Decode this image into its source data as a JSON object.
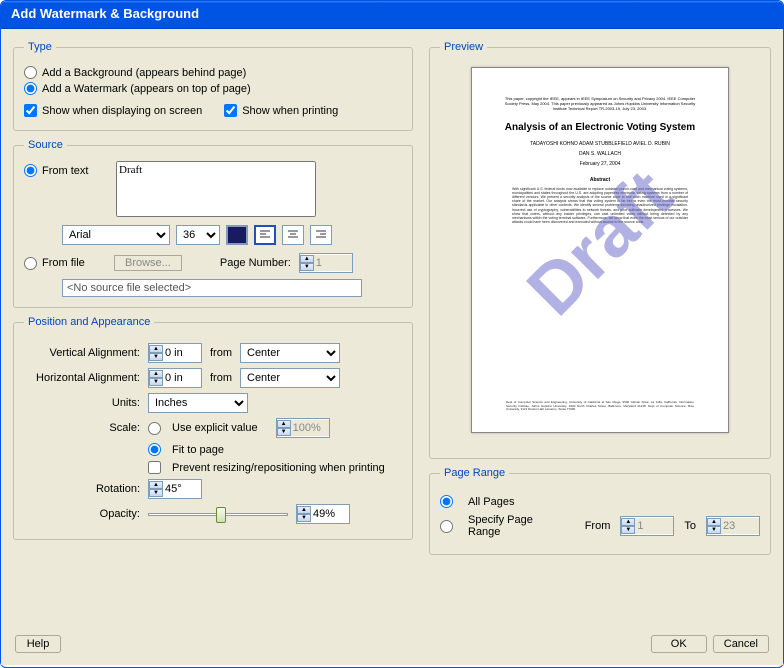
{
  "title": "Add Watermark & Background",
  "type": {
    "legend": "Type",
    "bg_label": "Add a Background (appears behind page)",
    "wm_label": "Add a Watermark (appears on top of page)",
    "show_screen": "Show when displaying on screen",
    "show_print": "Show when printing"
  },
  "source": {
    "legend": "Source",
    "from_text_label": "From text",
    "text_value": "Draft",
    "font": "Arial",
    "size": "36",
    "from_file_label": "From file",
    "browse": "Browse...",
    "page_number_label": "Page Number:",
    "page_number": "1",
    "no_source": "<No source file selected>"
  },
  "position": {
    "legend": "Position and Appearance",
    "valign_label": "Vertical Alignment:",
    "valign_val": "0 in",
    "from": "from",
    "center": "Center",
    "halign_label": "Horizontal Alignment:",
    "halign_val": "0 in",
    "units_label": "Units:",
    "units": "Inches",
    "scale_label": "Scale:",
    "explicit": "Use explicit value",
    "explicit_val": "100%",
    "fit": "Fit to page",
    "prevent": "Prevent resizing/repositioning when printing",
    "rotation_label": "Rotation:",
    "rotation": "45°",
    "opacity_label": "Opacity:",
    "opacity": "49%"
  },
  "preview": {
    "legend": "Preview",
    "watermark": "Draft",
    "doc_header": "This paper, copyright the IEEE, appears in IEEE Symposium on Security and Privacy 2004. IEEE Computer Society Press, May 2004. This paper previously appeared as Johns Hopkins University Information Security Institute Technical Report TR-2003-19, July 23, 2003.",
    "doc_title": "Analysis of an Electronic Voting System",
    "authors": "TADAYOSHI KOHNO    ADAM STUBBLEFIELD    AVIEL D. RUBIN",
    "authors2": "DAN S. WALLACH",
    "date": "February 27, 2004",
    "abstract_h": "Abstract",
    "abstract": "With significant U.S. federal funds now available to replace outdated punch-card and mechanical voting systems, municipalities and states throughout the U.S. are adopting paperless electronic voting systems from a number of different vendors. We present a security analysis of the source code to one such machine used in a significant share of the market. Our analysis shows that this voting system is far below even the most minimal security standards applicable in other contexts. We identify several problems including unauthorized privilege escalation, incorrect use of cryptography, vulnerabilities to network threats, and poor software development processes. We show that voters, without any insider privileges, can cast unlimited votes without being detected by any mechanisms within the voting terminal software. Furthermore, we show that even the most serious of our outsider attacks could have been discovered and executed without access to the source code.",
    "foot": "Dept of Computer Science and Engineering, University of California at San Diego, 9500 Gilman Drive, La Jolla, California. Information Security Institute, Johns Hopkins University, 3400 North Charles Street, Baltimore, Maryland 21218. Dept of Computer Science, Rice University, 3121 Duxton Hall, Houston, Texas 77005."
  },
  "pagerange": {
    "legend": "Page Range",
    "all": "All Pages",
    "specify": "Specify Page Range",
    "from_label": "From",
    "from_val": "1",
    "to_label": "To",
    "to_val": "23"
  },
  "buttons": {
    "help": "Help",
    "ok": "OK",
    "cancel": "Cancel"
  }
}
